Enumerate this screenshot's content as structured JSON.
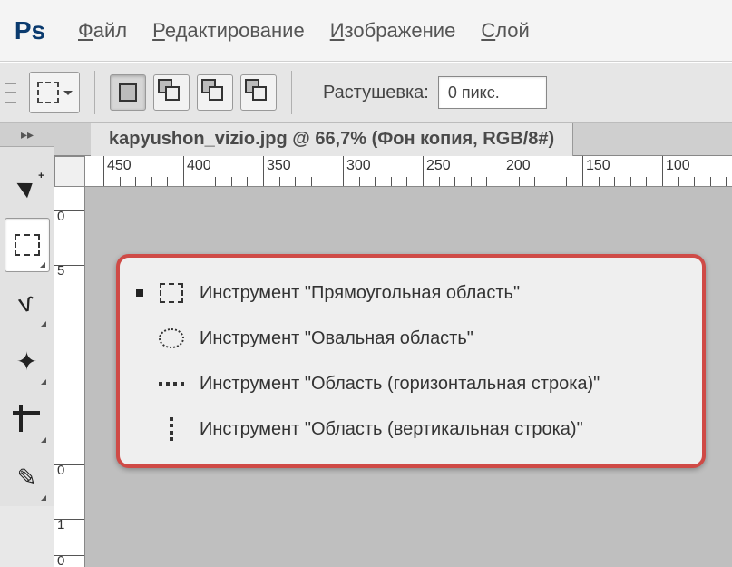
{
  "app": {
    "logo_text": "Ps"
  },
  "menubar": {
    "file": "Файл",
    "edit": "Редактирование",
    "image": "Изображение",
    "layer": "Слой"
  },
  "optionsbar": {
    "feather_label": "Растушевка:",
    "feather_value": "0 пикс."
  },
  "document": {
    "tab_title": "kapyushon_vizio.jpg @ 66,7% (Фон копия, RGB/8#)"
  },
  "ruler_h": [
    "450",
    "400",
    "350",
    "300",
    "250",
    "200",
    "150",
    "100"
  ],
  "ruler_v": [
    "0",
    "5",
    "0",
    "1",
    "0"
  ],
  "flyout": {
    "items": [
      {
        "label": "Инструмент \"Прямоугольная область\"",
        "icon": "rect",
        "selected": true
      },
      {
        "label": "Инструмент \"Овальная область\"",
        "icon": "ellipse",
        "selected": false
      },
      {
        "label": "Инструмент \"Область (горизонтальная строка)\"",
        "icon": "hline",
        "selected": false
      },
      {
        "label": "Инструмент \"Область (вертикальная строка)\"",
        "icon": "vline",
        "selected": false
      }
    ]
  }
}
